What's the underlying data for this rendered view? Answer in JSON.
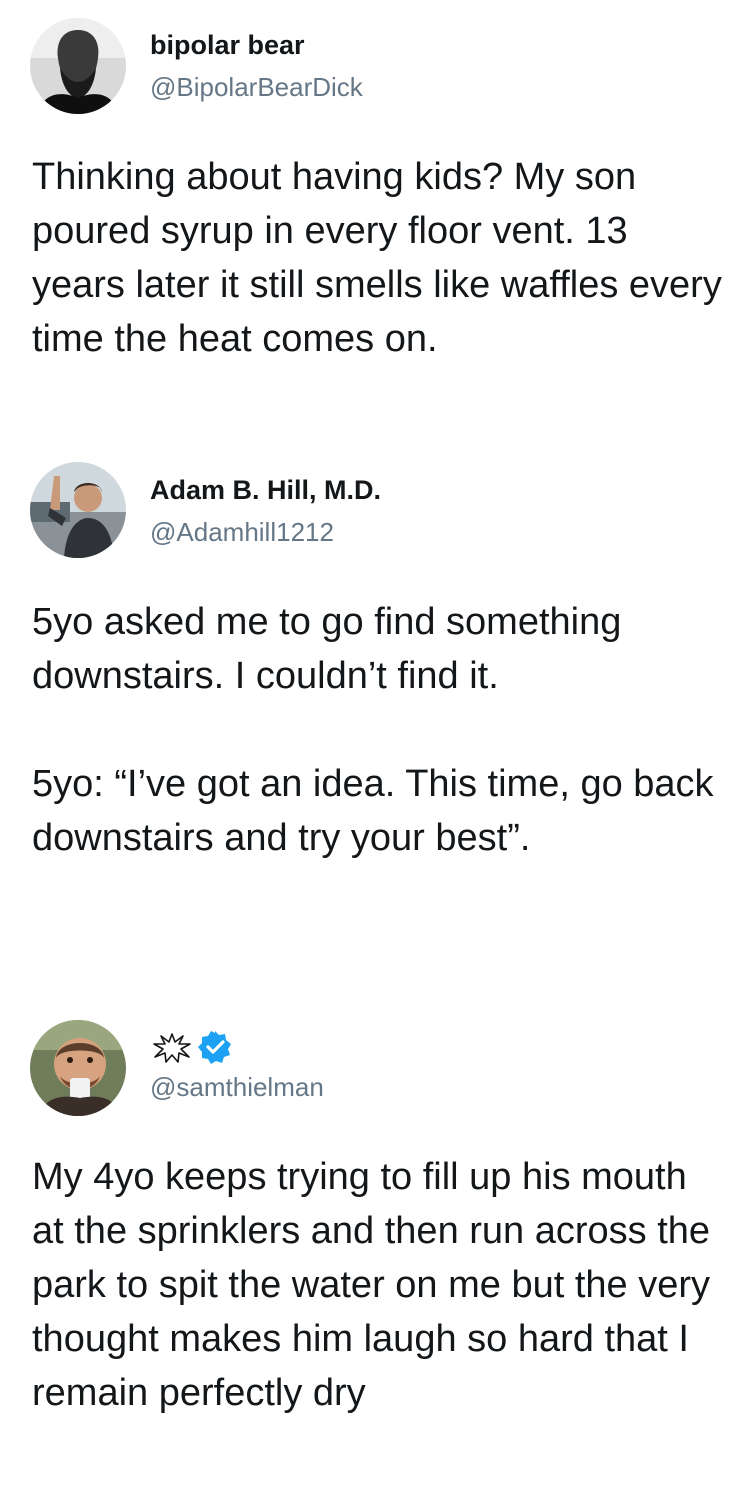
{
  "tweets": [
    {
      "display_name": "bipolar bear",
      "handle": "@BipolarBearDick",
      "paragraphs": [
        "Thinking about having kids? My son poured syrup in every floor vent. 13 years later it still smells like waffles every time the heat comes on."
      ],
      "avatar_icon": "bearded-man-avatar"
    },
    {
      "display_name": "Adam B. Hill, M.D.",
      "handle": "@Adamhill1212",
      "paragraphs": [
        "5yo asked me to go find something downstairs. I couldn’t find it.",
        "5yo: “I’ve got an idea. This time, go back downstairs and try your best”."
      ],
      "avatar_icon": "waving-man-avatar"
    },
    {
      "display_name": "",
      "handle": "@samthielman",
      "paragraphs": [
        "My 4yo keeps trying to fill up his mouth at the sprinklers and then run across the park to spit the water on me but the very thought makes him laugh so hard that I remain perfectly dry"
      ],
      "avatar_icon": "drinking-man-avatar",
      "name_icon": "sparkle-burst-icon",
      "verified": true
    }
  ],
  "colors": {
    "text": "#14171a",
    "handle": "#657786",
    "verified": "#1da1f2"
  }
}
